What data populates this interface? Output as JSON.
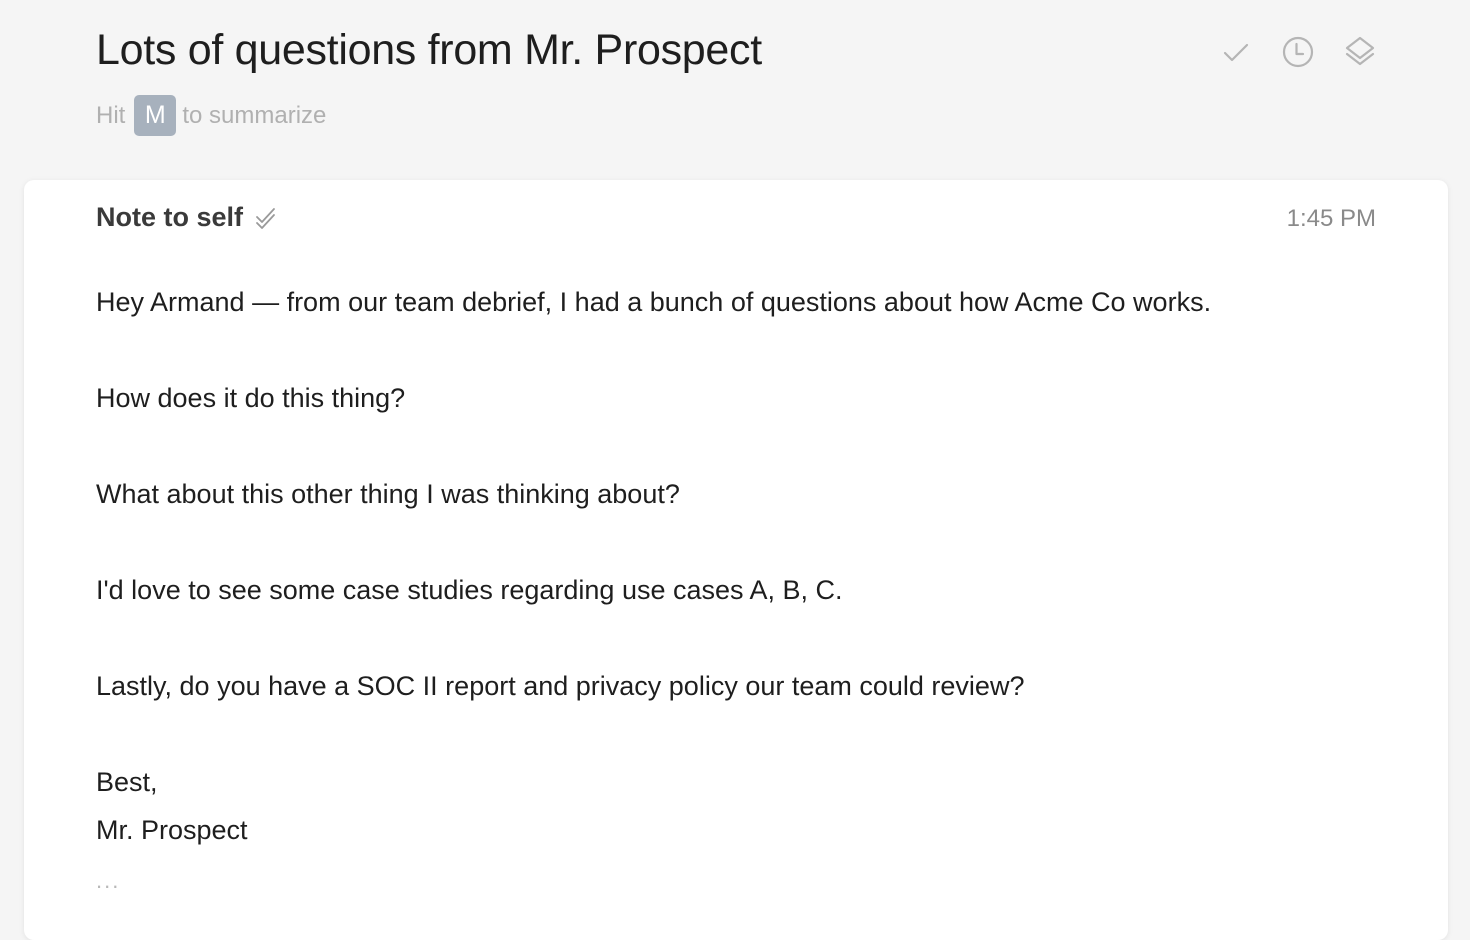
{
  "header": {
    "title": "Lots of questions from Mr. Prospect",
    "hint_prefix": "Hit",
    "hint_key": "M",
    "hint_suffix": "to summarize",
    "actions": [
      {
        "name": "done",
        "icon": "checkmark-icon"
      },
      {
        "name": "remind",
        "icon": "clock-icon"
      },
      {
        "name": "move",
        "icon": "layers-icon"
      }
    ]
  },
  "message": {
    "sender": "Note to self",
    "time": "1:45 PM",
    "paragraphs": [
      "Hey Armand — from our team debrief, I had a bunch of questions about how Acme Co works.",
      "How does it do this thing?",
      "What about this other thing I was thinking about?",
      "I'd love to see some case studies regarding use cases A, B, C.",
      "Lastly, do you have a SOC II report and privacy policy our team could review?"
    ],
    "signoff": "Best,",
    "signature": "Mr. Prospect",
    "more": "..."
  },
  "colors": {
    "background": "#f5f5f5",
    "card": "#ffffff",
    "key_badge": "#a7b1bd",
    "muted_text": "#b0b0b0",
    "icon": "#b5b5b5"
  }
}
